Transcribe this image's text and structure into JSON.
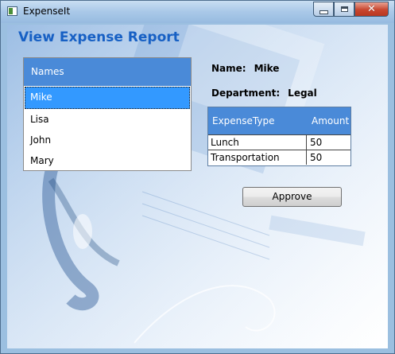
{
  "window": {
    "title": "ExpenseIt",
    "close_glyph": "✕"
  },
  "page": {
    "title": "View Expense Report"
  },
  "names": {
    "header": "Names",
    "items": [
      "Mike",
      "Lisa",
      "John",
      "Mary"
    ],
    "selected_index": 0
  },
  "details": {
    "name_label": "Name:",
    "name_value": "Mike",
    "department_label": "Department:",
    "department_value": "Legal"
  },
  "expenses": {
    "columns": [
      "ExpenseType",
      "Amount"
    ],
    "rows": [
      [
        "Lunch",
        "50"
      ],
      [
        "Transportation",
        "50"
      ]
    ]
  },
  "actions": {
    "approve_label": "Approve"
  },
  "colors": {
    "title_blue": "#1760c4",
    "header_blue": "#4a8ad8",
    "selection_blue": "#3399ff"
  }
}
